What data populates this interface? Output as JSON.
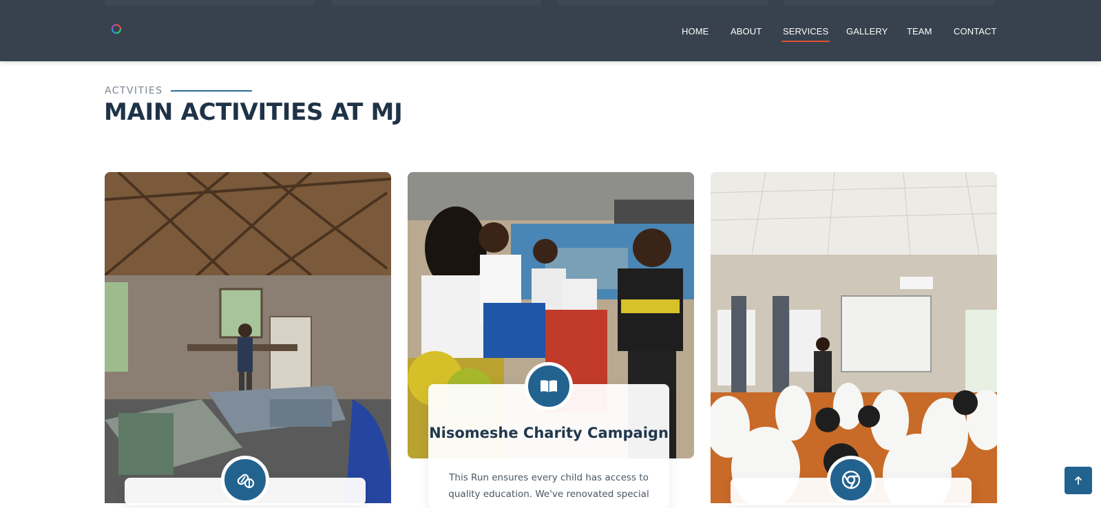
{
  "nav": {
    "items": [
      "HOME",
      "ABOUT",
      "SERVICES",
      "GALLERY",
      "TEAM",
      "CONTACT"
    ],
    "active": "SERVICES"
  },
  "section": {
    "eyebrow": "ACTVITIES",
    "title": "MAIN ACTIVITIES AT MJ"
  },
  "cards": [
    {
      "image": "workshop-photo",
      "icon": "pill-icon",
      "title": "",
      "text": ""
    },
    {
      "image": "charity-photo",
      "icon": "book-icon",
      "title": "Nisomeshe Charity Campaign",
      "text": "This Run ensures every child has access to quality education. We've renovated special"
    },
    {
      "image": "classroom-photo",
      "icon": "chrome-icon",
      "title": "",
      "text": ""
    }
  ],
  "colors": {
    "header_bg": "#37424e",
    "accent": "#22628f",
    "active_underline": "#e25030",
    "title": "#1f3348"
  },
  "back_to_top": {
    "icon": "arrow-up-icon"
  }
}
